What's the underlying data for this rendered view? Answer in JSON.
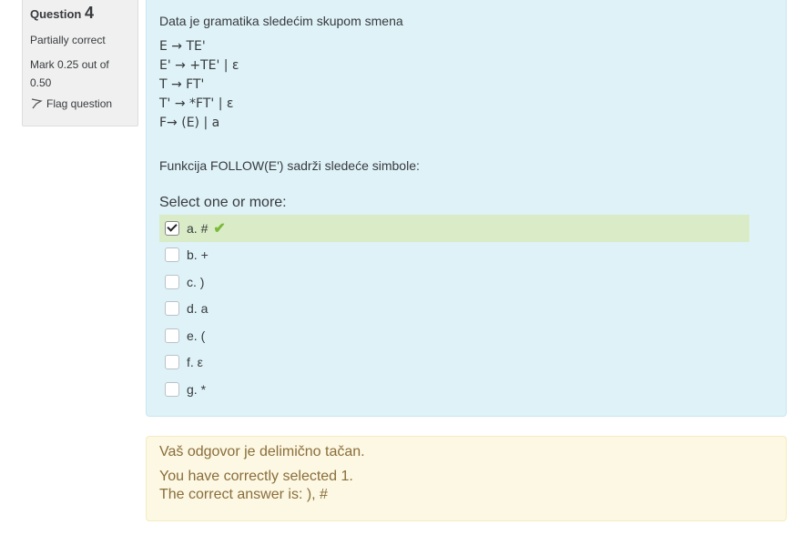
{
  "info": {
    "question_label": "Question",
    "question_number": "4",
    "state": "Partially correct",
    "grade": "Mark 0.25 out of 0.50",
    "flag_label": "Flag question"
  },
  "question": {
    "intro": "Data je gramatika sledećim skupom smena",
    "grammar": [
      "E → TE'",
      "E' → +TE' | ε",
      "T → FT'",
      "T' → *FT' | ε",
      "F→ (E) | a"
    ],
    "follow_text": "Funkcija FOLLOW(E') sadrži sledeće simbole:",
    "prompt": "Select one or more:",
    "options": [
      {
        "letter": "a.",
        "text": "#",
        "checked": true,
        "correct": true
      },
      {
        "letter": "b.",
        "text": "+",
        "checked": false,
        "correct": false
      },
      {
        "letter": "c.",
        "text": ")",
        "checked": false,
        "correct": false
      },
      {
        "letter": "d.",
        "text": "a",
        "checked": false,
        "correct": false
      },
      {
        "letter": "e.",
        "text": "(",
        "checked": false,
        "correct": false
      },
      {
        "letter": "f.",
        "text": "ε",
        "checked": false,
        "correct": false
      },
      {
        "letter": "g.",
        "text": "*",
        "checked": false,
        "correct": false
      }
    ]
  },
  "feedback": {
    "partial": "Vaš odgovor je delimično tačan.",
    "selected": "You have correctly selected 1.",
    "right_answer": "The correct answer is: ), #"
  },
  "colors": {
    "formulation_bg": "#def2f8",
    "correct_bg": "#d9ecc7",
    "tick": "#7bb93a",
    "feedback_bg": "#fcf8e3",
    "feedback_text": "#8a6d3b"
  }
}
